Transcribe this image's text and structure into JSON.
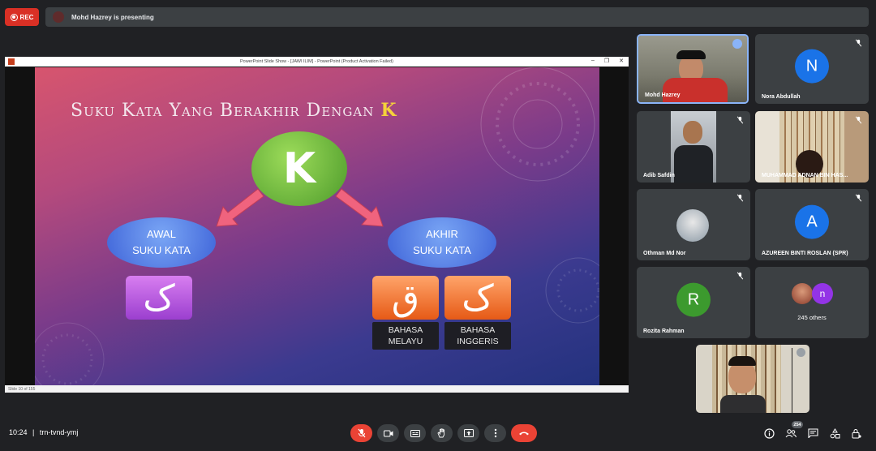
{
  "top_bar": {
    "rec_label": "REC",
    "presenting_text": "Mohd Hazrey is presenting"
  },
  "presentation_window": {
    "title": "PowerPoint Slide Show - [JAWI ILIM] - PowerPoint (Product Activation Failed)",
    "status": "Slide 10 of 155"
  },
  "slide": {
    "title_main": "Suku Kata Yang Berakhir Dengan",
    "title_letter": "K",
    "center_letter": "K",
    "left_oval": [
      "AWAL",
      "SUKU KATA"
    ],
    "right_oval": [
      "AKHIR",
      "SUKU KATA"
    ],
    "left_glyph": "ک",
    "right_glyph_1": "ق",
    "right_glyph_2": "ک",
    "label_1": [
      "BAHASA",
      "MELAYU"
    ],
    "label_2": [
      "BAHASA",
      "INGGERIS"
    ]
  },
  "participants": [
    {
      "name": "Mohd Hazrey",
      "type": "video",
      "speaking": true
    },
    {
      "name": "Nora Abdullah",
      "type": "avatar",
      "letter": "N",
      "color": "#1a73e8"
    },
    {
      "name": "Adib Safdin",
      "type": "video"
    },
    {
      "name": "MUHAMMAD ADNAN BIN HAS...",
      "type": "video"
    },
    {
      "name": "Othman Md Nor",
      "type": "photo"
    },
    {
      "name": "AZUREEN BINTI ROSLAN (SPR)",
      "type": "avatar",
      "letter": "A",
      "color": "#1a73e8"
    },
    {
      "name": "Rozita Rahman",
      "type": "avatar",
      "letter": "R",
      "color": "#3c9a2e"
    },
    {
      "name": "245 others",
      "type": "others",
      "letter": "n",
      "color": "#9334e6"
    }
  ],
  "bottom_bar": {
    "time": "10:24",
    "separator": "|",
    "meeting_code": "trn-tvnd-ymj",
    "people_count": "254"
  },
  "colors": {
    "background": "#202124",
    "tile": "#3c4043",
    "danger": "#ea4335",
    "speaking_border": "#8ab4f8"
  }
}
